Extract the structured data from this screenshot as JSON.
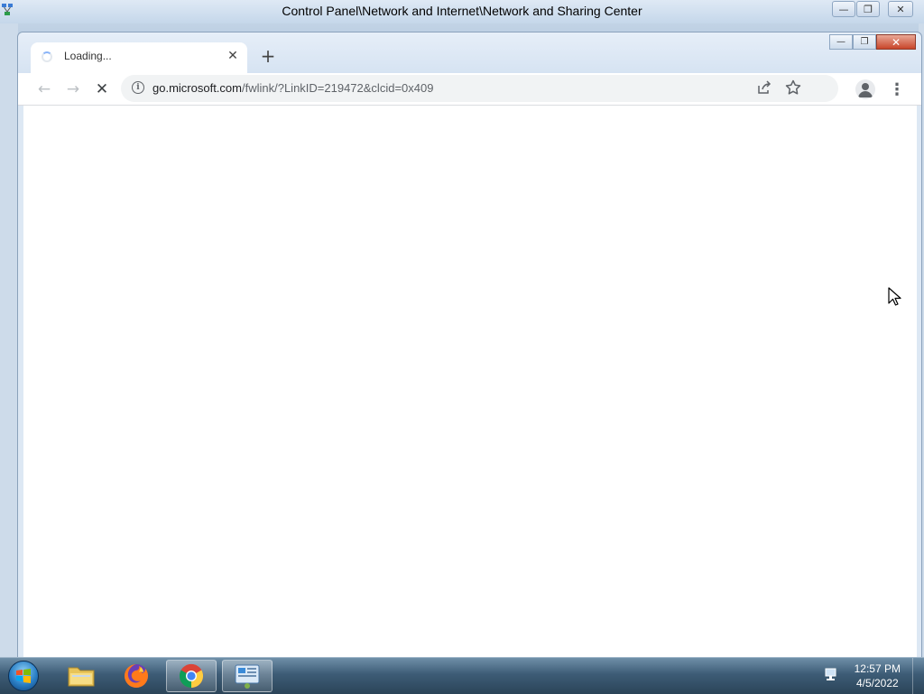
{
  "background_window": {
    "title": "Control Panel\\Network and Internet\\Network and Sharing Center"
  },
  "browser": {
    "tab": {
      "title": "Loading..."
    },
    "address": {
      "host": "go.microsoft.com",
      "path": "/fwlink/?LinkID=219472&clcid=0x409"
    }
  },
  "taskbar": {
    "apps": [
      {
        "name": "Windows Explorer",
        "icon": "folder-icon"
      },
      {
        "name": "Firefox",
        "icon": "firefox-icon"
      },
      {
        "name": "Google Chrome",
        "icon": "chrome-icon"
      },
      {
        "name": "Control Panel",
        "icon": "control-panel-icon"
      }
    ],
    "clock": {
      "time": "12:57 PM",
      "date": "4/5/2022"
    }
  },
  "colors": {
    "taskbar": "#3d5c76",
    "close_button": "#c8452a",
    "omnibox": "#f1f3f4"
  }
}
